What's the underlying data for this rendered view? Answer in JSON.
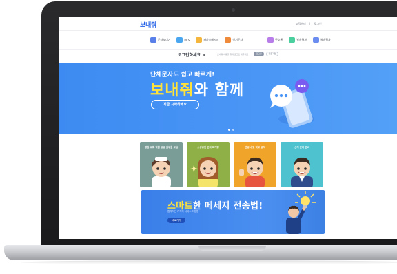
{
  "header": {
    "logo": "보내줘",
    "top_links": [
      "고객센터",
      "로그인"
    ]
  },
  "menu": {
    "items": [
      {
        "label": "문자보내기",
        "icon": "sms-icon",
        "color": "#5b7fe8"
      },
      {
        "label": "RCS",
        "icon": "rcs-icon",
        "color": "#4aa7ef"
      },
      {
        "label": "카카오메시지",
        "icon": "kakao-icon",
        "color": "#f4b63c"
      },
      {
        "label": "선거문자",
        "icon": "vote-icon",
        "color": "#ef8a3b"
      },
      {
        "label": "주소록",
        "icon": "address-book-icon",
        "color": "#b87de9"
      },
      {
        "label": "발송결과",
        "icon": "result-icon",
        "color": "#4ccf9e"
      },
      {
        "label": "발송결과",
        "icon": "chart-icon",
        "color": "#6c8df0"
      }
    ]
  },
  "login_bar": {
    "login_text": "로그인하세요 >",
    "note": "보내줘 이용을 위해 로그인 해주세요",
    "login_button": "로그인",
    "signup_button": "회원가입"
  },
  "hero": {
    "subtitle": "단체문자도 쉽고 빠르게!",
    "title_highlight": "보내줘",
    "title_rest": "와 함께",
    "cta": "지금 시작하세요"
  },
  "cards": [
    {
      "label": "병원·교회·학원 공공 실무들 \n모음",
      "color": "#7a9e97"
    },
    {
      "label": "소상공인 문자 \n마케팅",
      "color": "#8fb046"
    },
    {
      "label": "관공서 및 학교 \n공지",
      "color": "#f0a52a"
    },
    {
      "label": "선거 문자 \n준비",
      "color": "#4ec2cf"
    }
  ],
  "promo": {
    "title_highlight": "스마트",
    "title_rest": "한 메세지 전송법!",
    "subtitle": "합리적인 가격의 서비스 이용법",
    "button": "바로가기"
  },
  "colors": {
    "brand_blue": "#2462e8",
    "hero_blue": "#4a96f6",
    "highlight_yellow": "#ffe23a"
  }
}
